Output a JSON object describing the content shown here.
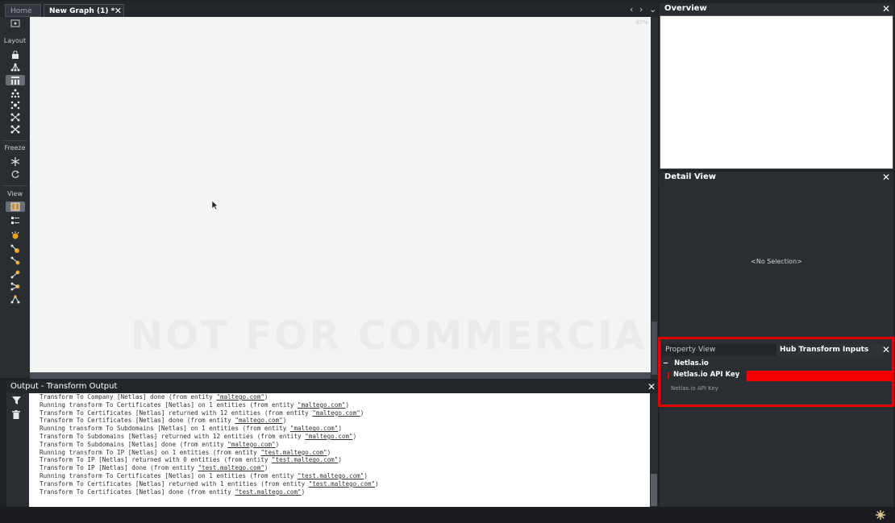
{
  "tabs": {
    "home": "Home",
    "active": "New Graph (1) *"
  },
  "toolbar": {
    "layout_label": "Layout",
    "freeze_label": "Freeze",
    "view_label": "View"
  },
  "graph": {
    "zoom": "80%",
    "watermark": "NOT FOR COMMERCIAL USE"
  },
  "output": {
    "title": "Output - Transform Output",
    "lines": [
      {
        "text": "Transform To Company [Netlas] done (from entity ",
        "link": "\"maltego.com\"",
        "tail": ")"
      },
      {
        "text": "Running transform To Certificates [Netlas] on 1 entities (from entity ",
        "link": "\"maltego.com\"",
        "tail": ")"
      },
      {
        "text": "Transform To Certificates [Netlas] returned with 12 entities (from entity ",
        "link": "\"maltego.com\"",
        "tail": ")"
      },
      {
        "text": "Transform To Certificates [Netlas] done (from entity ",
        "link": "\"maltego.com\"",
        "tail": ")"
      },
      {
        "text": "Running transform To Subdomains [Netlas] on 1 entities (from entity ",
        "link": "\"maltego.com\"",
        "tail": ")"
      },
      {
        "text": "Transform To Subdomains [Netlas] returned with 12 entities (from entity ",
        "link": "\"maltego.com\"",
        "tail": ")"
      },
      {
        "text": "Transform To Subdomains [Netlas] done (from entity ",
        "link": "\"maltego.com\"",
        "tail": ")"
      },
      {
        "text": "Running transform To IP [Netlas] on 1 entities (from entity ",
        "link": "\"test.maltego.com\"",
        "tail": ")"
      },
      {
        "text": "Transform To IP [Netlas] returned with 0 entities (from entity ",
        "link": "\"test.maltego.com\"",
        "tail": ")"
      },
      {
        "text": "Transform To IP [Netlas] done (from entity ",
        "link": "\"test.maltego.com\"",
        "tail": ")"
      },
      {
        "text": "Running transform To Certificates [Netlas] on 1 entities (from entity ",
        "link": "\"test.maltego.com\"",
        "tail": ")"
      },
      {
        "text": "Transform To Certificates [Netlas] returned with 1 entities (from entity ",
        "link": "\"test.maltego.com\"",
        "tail": ")"
      },
      {
        "text": "Transform To Certificates [Netlas] done (from entity ",
        "link": "\"test.maltego.com\"",
        "tail": ")"
      }
    ]
  },
  "overview": {
    "title": "Overview"
  },
  "detail": {
    "title": "Detail View",
    "empty": "<No Selection>"
  },
  "property": {
    "tab_property": "Property View",
    "tab_hub": "Hub Transform Inputs",
    "group": "Netlas.io",
    "key_label": "Netlas.io API Key",
    "key_value": "",
    "key_desc": "Netlas.io API Key"
  },
  "colors": {
    "highlight": "#e00000",
    "input_fill": "#f40000"
  }
}
